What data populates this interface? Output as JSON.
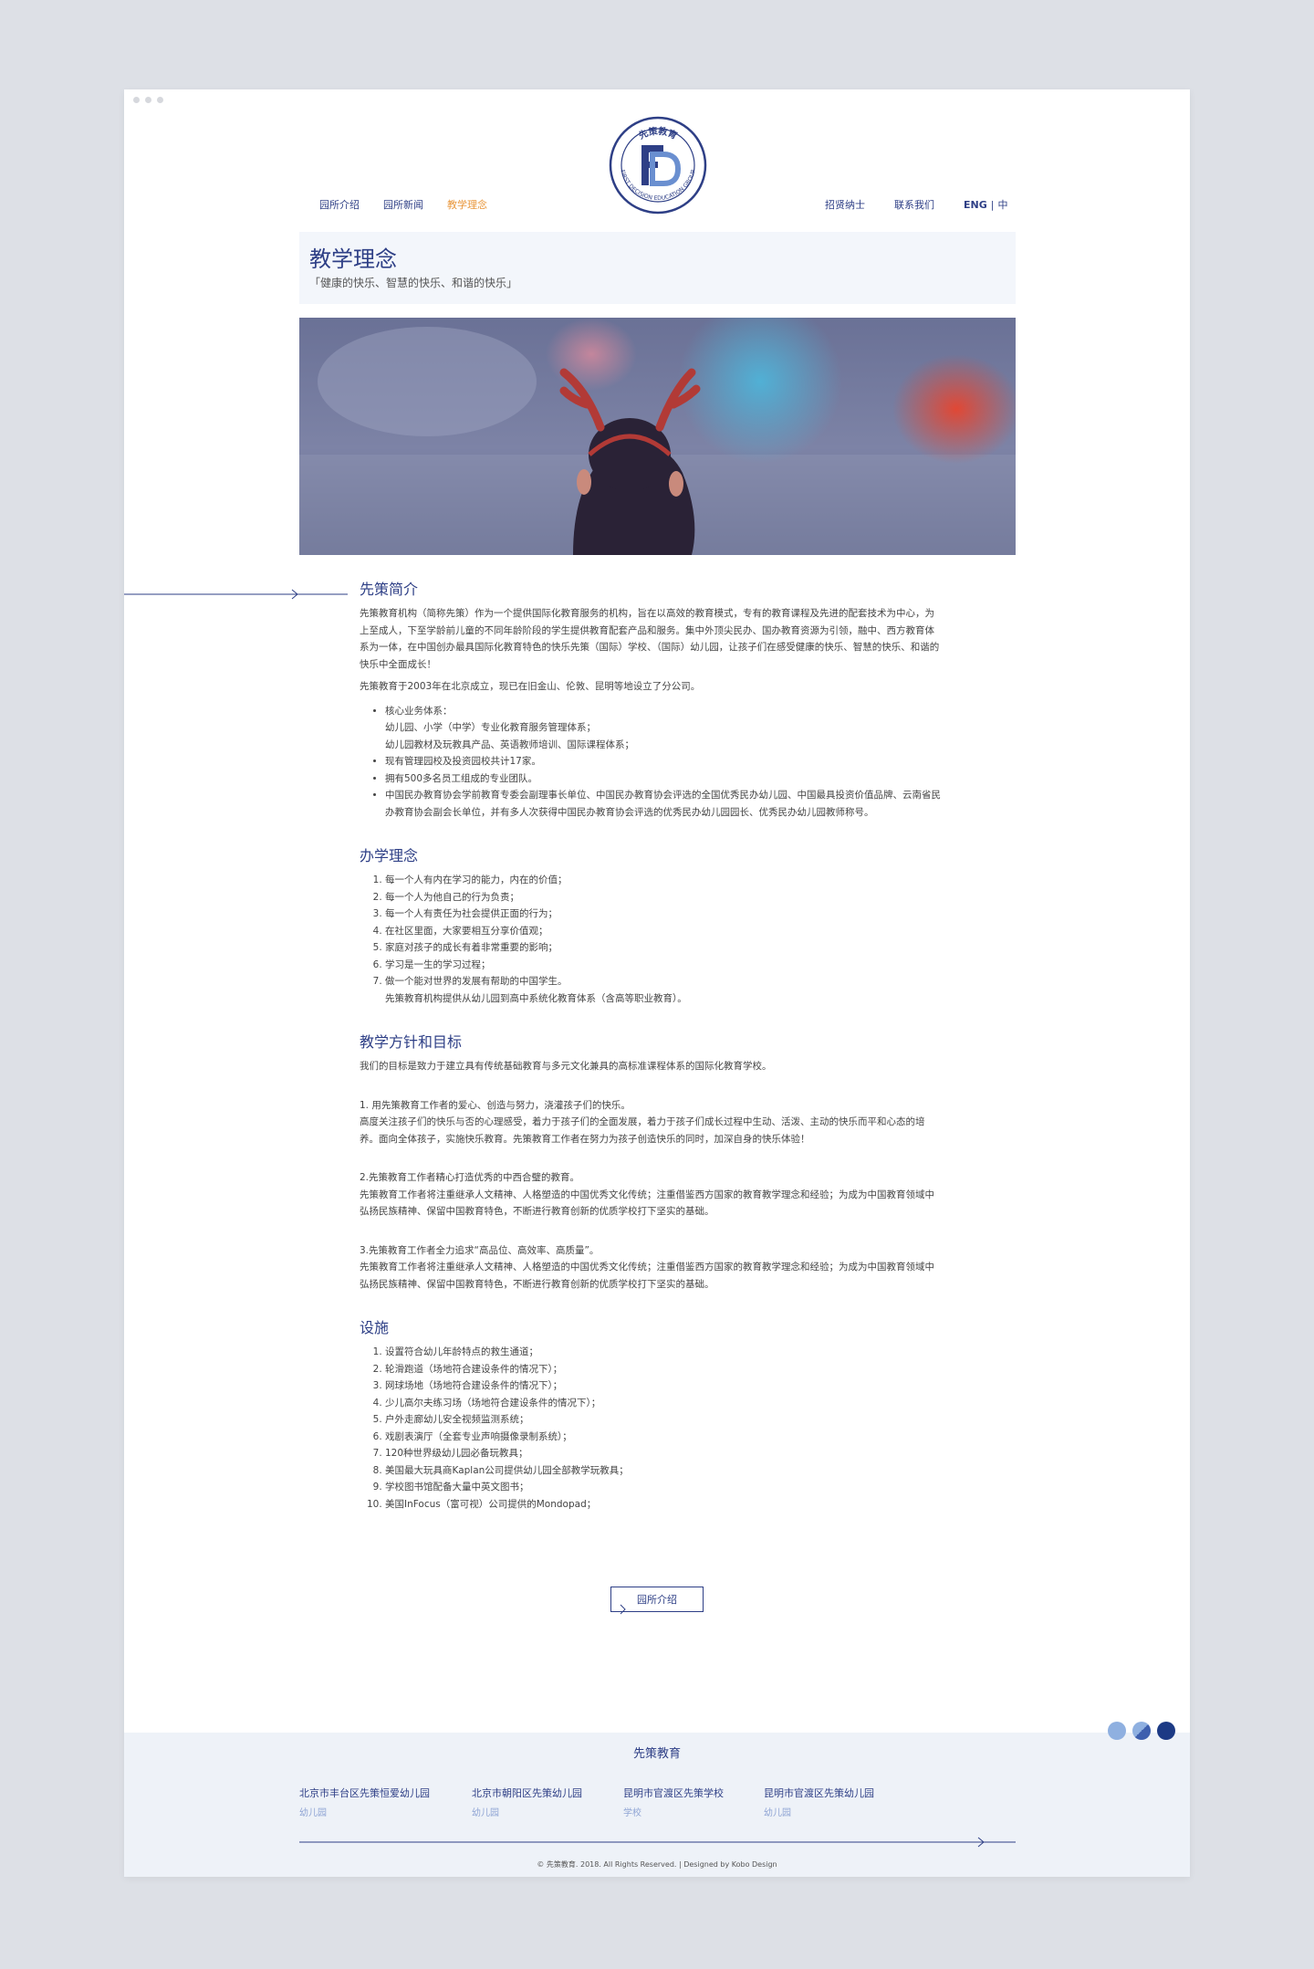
{
  "nav": {
    "left": [
      "园所介绍",
      "园所新闻",
      "教学理念"
    ],
    "active_index": 2,
    "right": [
      "招贤纳士",
      "联系我们"
    ],
    "lang_en": "ENG",
    "lang_sep": "|",
    "lang_zh": "中"
  },
  "logo": {
    "top_text": "先策教育",
    "ring_text": "FIRST DECISION EDUCATION GROUP",
    "monogram": "FD"
  },
  "hero": {
    "title": "教学理念",
    "subtitle": "「健康的快乐、智慧的快乐、和谐的快乐」"
  },
  "intro": {
    "heading": "先策简介",
    "p1": "先策教育机构（简称先策）作为一个提供国际化教育服务的机构，旨在以高效的教育模式，专有的教育课程及先进的配套技术为中心，为上至成人，下至学龄前儿童的不同年龄阶段的学生提供教育配套产品和服务。集中外顶尖民办、国办教育资源为引领，融中、西方教育体系为一体，在中国创办最具国际化教育特色的快乐先策（国际）学校、（国际）幼儿园，让孩子们在感受健康的快乐、智慧的快乐、和谐的快乐中全面成长！",
    "p2": "先策教育于2003年在北京成立，现已在旧金山、伦敦、昆明等地设立了分公司。",
    "bullet1_title": "核心业务体系：",
    "bullet1_line1": "幼儿园、小学（中学）专业化教育服务管理体系；",
    "bullet1_line2": "幼儿园教材及玩教具产品、英语教师培训、国际课程体系；",
    "bullet2": "现有管理园校及投资园校共计17家。",
    "bullet3": "拥有500多名员工组成的专业团队。",
    "bullet4": "中国民办教育协会学前教育专委会副理事长单位、中国民办教育协会评选的全国优秀民办幼儿园、中国最具投资价值品牌、云南省民办教育协会副会长单位，并有多人次获得中国民办教育协会评选的优秀民办幼儿园园长、优秀民办幼儿园教师称号。"
  },
  "philosophy": {
    "heading": "办学理念",
    "items": [
      "每一个人有内在学习的能力，内在的价值；",
      "每一个人为他自己的行为负责；",
      "每一个人有责任为社会提供正面的行为；",
      "在社区里面，大家要相互分享价值观；",
      "家庭对孩子的成长有着非常重要的影响；",
      "学习是一生的学习过程；",
      "做一个能对世界的发展有帮助的中国学生。"
    ],
    "note": "先策教育机构提供从幼儿园到高中系统化教育体系（含高等职业教育）。"
  },
  "goals": {
    "heading": "教学方针和目标",
    "intro": "我们的目标是致力于建立具有传统基础教育与多元文化兼具的高标准课程体系的国际化教育学校。",
    "g1_title": "1. 用先策教育工作者的爱心、创造与努力，浇灌孩子们的快乐。",
    "g1_body": "高度关注孩子们的快乐与否的心理感受，着力于孩子们的全面发展，着力于孩子们成长过程中生动、活泼、主动的快乐而平和心态的培养。面向全体孩子，实施快乐教育。先策教育工作者在努力为孩子创造快乐的同时，加深自身的快乐体验！",
    "g2_title": "2.先策教育工作者精心打造优秀的中西合璧的教育。",
    "g2_body": "先策教育工作者将注重继承人文精神、人格塑造的中国优秀文化传统；注重借鉴西方国家的教育教学理念和经验；为成为中国教育领域中弘扬民族精神、保留中国教育特色，不断进行教育创新的优质学校打下坚实的基础。",
    "g3_title": "3.先策教育工作者全力追求“高品位、高效率、高质量”。",
    "g3_body": "先策教育工作者将注重继承人文精神、人格塑造的中国优秀文化传统；注重借鉴西方国家的教育教学理念和经验；为成为中国教育领域中弘扬民族精神、保留中国教育特色，不断进行教育创新的优质学校打下坚实的基础。"
  },
  "facilities": {
    "heading": "设施",
    "items": [
      "设置符合幼儿年龄特点的救生通道；",
      "轮滑跑道（场地符合建设条件的情况下）；",
      "网球场地（场地符合建设条件的情况下）；",
      "少儿高尔夫练习场（场地符合建设条件的情况下）；",
      "户外走廊幼儿安全视频监测系统；",
      "戏剧表演厅（全套专业声响摄像录制系统）；",
      "120种世界级幼儿园必备玩教具；",
      "美国最大玩具商Kaplan公司提供幼儿园全部教学玩教具；",
      "学校图书馆配备大量中英文图书；",
      "美国InFocus（富可视）公司提供的Mondopad；"
    ]
  },
  "button": {
    "label": "园所介绍"
  },
  "palette": [
    "#8fb0e0",
    "#3e5fae",
    "#1c3a85"
  ],
  "footer": {
    "title": "先策教育",
    "schools": [
      {
        "name": "北京市丰台区先策恒爱幼儿园",
        "type": "幼儿园"
      },
      {
        "name": "北京市朝阳区先策幼儿园",
        "type": "幼儿园"
      },
      {
        "name": "昆明市官渡区先策学校",
        "type": "学校"
      },
      {
        "name": "昆明市官渡区先策幼儿园",
        "type": "幼儿园"
      }
    ],
    "copyright": "© 先策教育. 2018. All Rights Reserved. | Designed by Kobo Design"
  }
}
